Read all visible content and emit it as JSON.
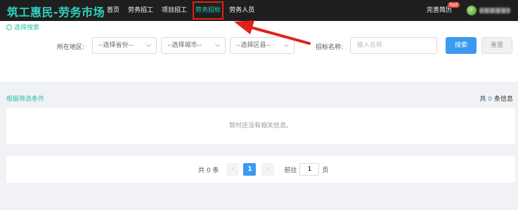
{
  "header": {
    "brand": "筑工惠民-劳务市场",
    "nav": [
      {
        "label": "首页"
      },
      {
        "label": "劳务招工"
      },
      {
        "label": "项目招工"
      },
      {
        "label": "劳务招标"
      },
      {
        "label": "劳务人员"
      }
    ],
    "active_nav": "劳务招标",
    "resume": "完善简历",
    "hot_badge": "hot"
  },
  "filter": {
    "title": "选择搜索",
    "region_label": "所在地区:",
    "province_placeholder": "--选择省份--",
    "city_placeholder": "--选择城市--",
    "district_placeholder": "--选择区县--",
    "name_label": "招标名称:",
    "name_placeholder": "输入名称",
    "search_button": "搜索",
    "reset_button": "重置"
  },
  "results": {
    "heading": "根据筛选条件",
    "count_prefix": "共",
    "count": "0",
    "count_suffix": "条信息",
    "empty_text": "暂时还没有相关信息。"
  },
  "pagination": {
    "total_text": "共 0 条",
    "current_page": "1",
    "goto_label": "前往",
    "goto_value": "1",
    "page_suffix": "页",
    "prev_icon": "‹",
    "next_icon": "›"
  },
  "colors": {
    "brand": "#2fd0c0",
    "accent": "#3a9af0",
    "annotation_red": "#e0201b"
  }
}
